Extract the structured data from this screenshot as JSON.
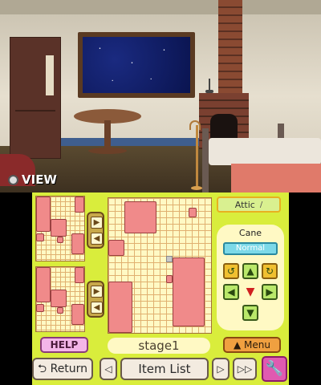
{
  "top_screen": {
    "view_label": "VIEW"
  },
  "panel": {
    "room_label": "Attic",
    "item": {
      "name": "Cane",
      "mode": "Normal"
    },
    "stage_label": "stage1",
    "help_label": "HELP",
    "menu_label": "Menu"
  },
  "footer": {
    "return_label": "Return",
    "item_list_label": "Item List"
  },
  "colors": {
    "panel_bg": "#d9ed3c",
    "furniture_pink": "#f08a8a",
    "help_pink": "#f4b6e8",
    "night_sky": "#0a1450"
  }
}
